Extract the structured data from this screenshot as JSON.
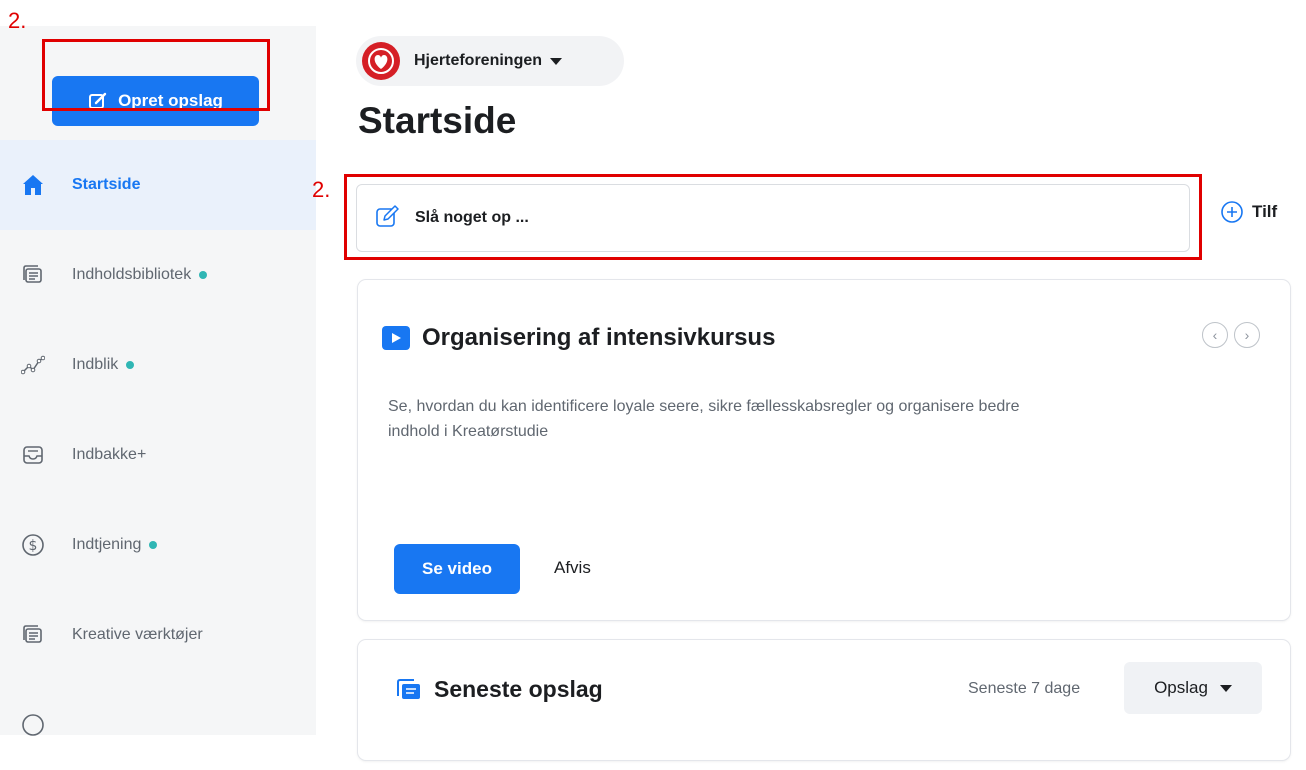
{
  "annotations": {
    "marker_top": "2.",
    "marker_search": "2."
  },
  "sidebar": {
    "create_button": "Opret opslag",
    "items": [
      {
        "label": "Startside",
        "icon": "home-icon",
        "active": true,
        "dot": false
      },
      {
        "label": "Indholdsbibliotek",
        "icon": "library-icon",
        "active": false,
        "dot": true
      },
      {
        "label": "Indblik",
        "icon": "insights-icon",
        "active": false,
        "dot": true
      },
      {
        "label": "Indbakke+",
        "icon": "inbox-icon",
        "active": false,
        "dot": false
      },
      {
        "label": "Indtjening",
        "icon": "dollar-icon",
        "active": false,
        "dot": true
      },
      {
        "label": "Kreative værktøjer",
        "icon": "tools-icon",
        "active": false,
        "dot": false
      }
    ]
  },
  "page_selector": {
    "name": "Hjerteforeningen"
  },
  "page_title": "Startside",
  "search": {
    "placeholder": "Slå noget op ..."
  },
  "add_button": {
    "label": "Tilf"
  },
  "course_card": {
    "title": "Organisering af intensivkursus",
    "description": "Se, hvordan du kan identificere loyale seere, sikre fællesskabsregler og organisere bedre indhold i Kreatørstudie",
    "primary_button": "Se video",
    "secondary_button": "Afvis"
  },
  "recent_posts": {
    "title": "Seneste opslag",
    "period": "Seneste 7 dage",
    "filter": "Opslag"
  },
  "colors": {
    "accent": "#1877f2",
    "annotation": "#e00000",
    "dot": "#2fb6b4"
  }
}
